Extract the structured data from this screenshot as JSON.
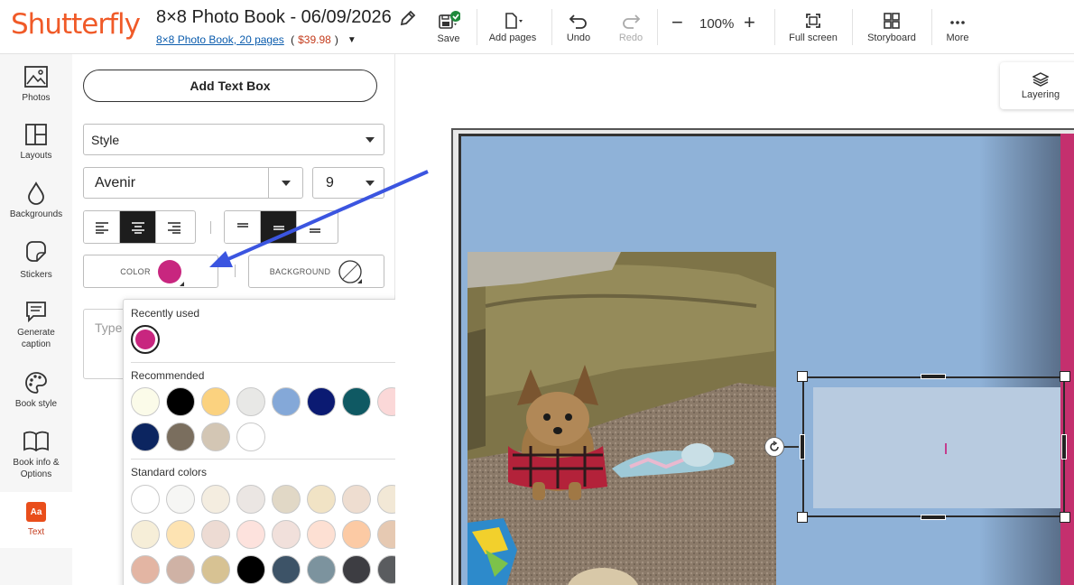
{
  "brand": "Shutterfly",
  "document": {
    "title": "8×8 Photo Book - 06/09/2026",
    "product_link": "8×8 Photo Book, 20 pages",
    "price": "$39.98"
  },
  "toolbar": {
    "save": "Save",
    "add_pages": "Add pages",
    "undo": "Undo",
    "redo": "Redo",
    "zoom": "100%",
    "full_screen": "Full screen",
    "storyboard": "Storyboard",
    "more": "More"
  },
  "leftnav": {
    "photos": "Photos",
    "layouts": "Layouts",
    "backgrounds": "Backgrounds",
    "stickers": "Stickers",
    "generate_caption": "Generate caption",
    "book_style": "Book style",
    "book_info": "Book info & Options",
    "text": "Text",
    "text_icon": "Aa"
  },
  "text_panel": {
    "add_text_box": "Add Text Box",
    "style_select": "Style",
    "font_select": "Avenir",
    "size_select": "9",
    "color_label": "COLOR",
    "color_value": "#c8267f",
    "background_label": "BACKGROUND",
    "text_placeholder": "Type"
  },
  "color_picker": {
    "recently_used_label": "Recently used",
    "recently_used": [
      "#c8267f"
    ],
    "recommended_label": "Recommended",
    "recommended": [
      "#fbfbe9",
      "#000000",
      "#fbd27f",
      "#e8e8e6",
      "#84a8d8",
      "#0b1a72",
      "#0f5963",
      "#fbd8d8",
      "#0c2560",
      "#7a6e5e",
      "#d3c6b4",
      "#ffffff"
    ],
    "standard_label": "Standard colors",
    "standard": [
      "#ffffff",
      "#f6f6f4",
      "#f4ede0",
      "#ebe6e3",
      "#e1d8c6",
      "#f1e3c5",
      "#eeddd0",
      "#f2e8d6",
      "#f6eed8",
      "#fde3b2",
      "#eddbd3",
      "#fde2dd",
      "#f1e0db",
      "#fde0d3",
      "#fccaa4",
      "#e6c9b2",
      "#e3b5a3",
      "#cfb2a5",
      "#d7c293",
      "#000000",
      "#3d5367",
      "#7c939e",
      "#3d3d42",
      "#5a5c5f"
    ]
  },
  "canvas": {
    "layering": "Layering"
  }
}
